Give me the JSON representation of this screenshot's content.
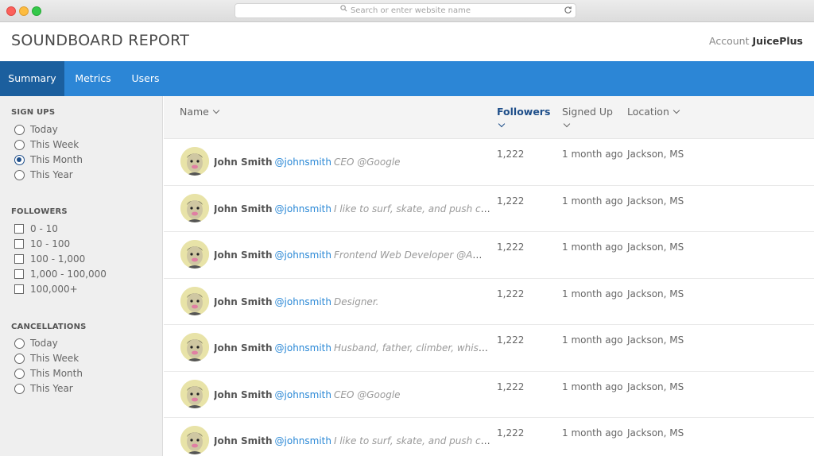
{
  "browser": {
    "url_placeholder": "Search or enter website name"
  },
  "header": {
    "title": "SOUNDBOARD REPORT",
    "account_label": "Account",
    "account_name": "JuicePlus"
  },
  "tabs": [
    {
      "label": "Summary",
      "active": true
    },
    {
      "label": "Metrics",
      "active": false
    },
    {
      "label": "Users",
      "active": false
    }
  ],
  "sidebar": {
    "signups": {
      "title": "SIGN UPS",
      "options": [
        "Today",
        "This Week",
        "This Month",
        "This Year"
      ],
      "selected": "This Month"
    },
    "followers": {
      "title": "FOLLOWERS",
      "options": [
        "0 - 10",
        "10 - 100",
        "100 - 1,000",
        "1,000 - 100,000",
        "100,000+"
      ]
    },
    "cancellations": {
      "title": "CANCELLATIONS",
      "options": [
        "Today",
        "This Week",
        "This Month",
        "This Year"
      ]
    }
  },
  "table": {
    "columns": {
      "name": "Name",
      "followers": "Followers",
      "signed_up": "Signed Up",
      "location": "Location"
    },
    "sorted_column": "Followers",
    "rows": [
      {
        "name": "John Smith",
        "handle": "@johnsmith",
        "bio": "CEO @Google",
        "followers": "1,222",
        "signed_up": "1 month ago",
        "location": "Jackson, MS"
      },
      {
        "name": "John Smith",
        "handle": "@johnsmith",
        "bio": "I like to surf, skate, and push code.",
        "followers": "1,222",
        "signed_up": "1 month ago",
        "location": "Jackson, MS"
      },
      {
        "name": "John Smith",
        "handle": "@johnsmith",
        "bio": "Frontend Web Developer @Amazo...",
        "followers": "1,222",
        "signed_up": "1 month ago",
        "location": "Jackson, MS"
      },
      {
        "name": "John Smith",
        "handle": "@johnsmith",
        "bio": "Designer.",
        "followers": "1,222",
        "signed_up": "1 month ago",
        "location": "Jackson, MS"
      },
      {
        "name": "John Smith",
        "handle": "@johnsmith",
        "bio": "Husband, father, climber, whiskey, ...",
        "followers": "1,222",
        "signed_up": "1 month ago",
        "location": "Jackson, MS"
      },
      {
        "name": "John Smith",
        "handle": "@johnsmith",
        "bio": "CEO @Google",
        "followers": "1,222",
        "signed_up": "1 month ago",
        "location": "Jackson, MS"
      },
      {
        "name": "John Smith",
        "handle": "@johnsmith",
        "bio": "I like to surf, skate, and push code.",
        "followers": "1,222",
        "signed_up": "1 month ago",
        "location": "Jackson, MS"
      }
    ]
  },
  "icons": {
    "search": "search-icon",
    "reload": "reload-icon",
    "sort": "chevron-down-icon",
    "avatar": "avatar"
  },
  "colors": {
    "nav_bar": "#2c86d6",
    "nav_active": "#1b5f9e",
    "handle": "#2a88d6",
    "sorted_header": "#1f4f8a"
  }
}
